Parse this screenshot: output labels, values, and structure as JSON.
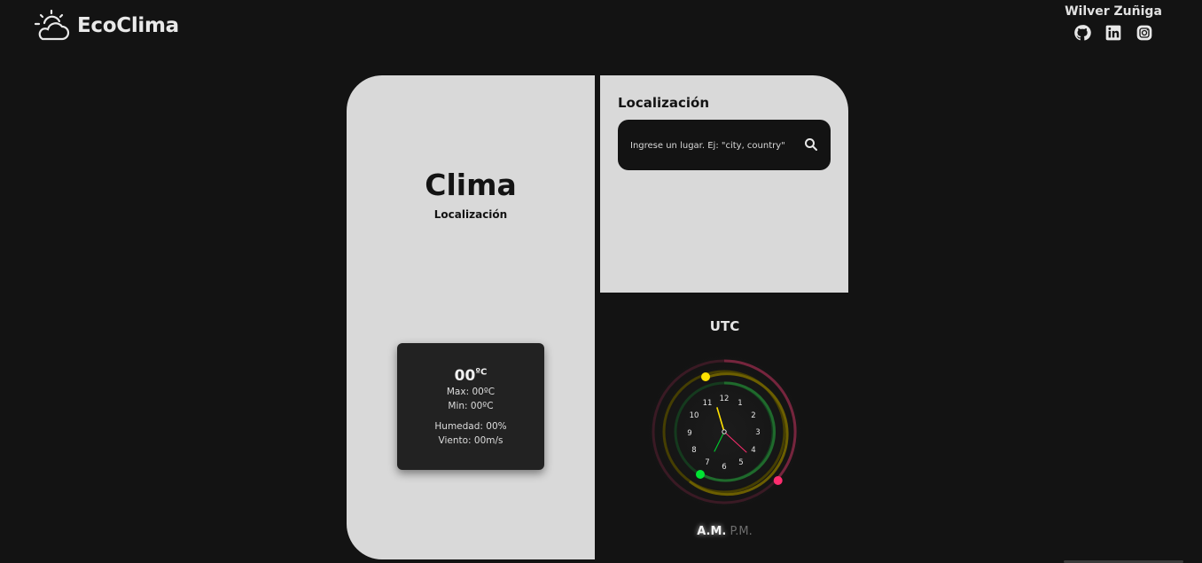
{
  "header": {
    "brand": "EcoClima",
    "brand_icon": "sun-cloud-icon",
    "author": "Wilver Zuñiga",
    "socials": [
      {
        "name": "github",
        "icon": "github-icon"
      },
      {
        "name": "linkedin",
        "icon": "linkedin-icon"
      },
      {
        "name": "instagram",
        "icon": "instagram-icon"
      }
    ]
  },
  "weather": {
    "title": "Clima",
    "location": "Localización",
    "temp": "00",
    "temp_unit": "ºC",
    "max": "Max: 00ºC",
    "min": "Min: 00ºC",
    "humidity": "Humedad: 00%",
    "wind": "Viento: 00m/s"
  },
  "search": {
    "title": "Localización",
    "placeholder": "Ingrese un lugar. Ej: \"city, country\"",
    "button_icon": "search-icon"
  },
  "clock": {
    "timezone": "UTC",
    "numbers": [
      "12",
      "1",
      "2",
      "3",
      "4",
      "5",
      "6",
      "7",
      "8",
      "9",
      "10",
      "11"
    ],
    "am": "A.M.",
    "pm": "P.M.",
    "period_active": "A.M.",
    "colors": {
      "hours": "#ffe100",
      "minutes": "#00e533",
      "seconds": "#ff2d6f"
    }
  },
  "colors": {
    "background": "#131313",
    "panel": "#d9d9d9",
    "weather_box": "#222222"
  }
}
